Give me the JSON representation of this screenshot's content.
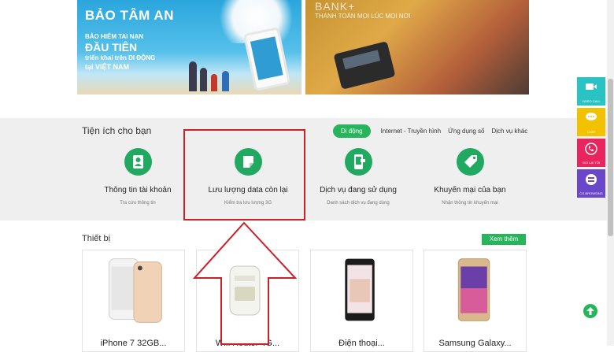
{
  "banner_left": {
    "title": "BẢO TÂM AN",
    "line1": "BẢO HIỂM TAI NẠN",
    "line2": "ĐẦU TIÊN",
    "line3": "triển khai trên DI ĐỘNG",
    "line4": "tại VIỆT NAM"
  },
  "banner_right": {
    "title": "BANK+",
    "subtitle": "THANH TOÁN MỌI LÚC MỌI NƠI"
  },
  "utilities": {
    "title": "Tiện ích cho bạn",
    "tabs": [
      "Di động",
      "Internet - Truyền hình",
      "Ứng dụng số",
      "Dịch vụ khác"
    ],
    "items": [
      {
        "label": "Thông tin tài khoản",
        "desc": "Tra cứu thông tin",
        "icon": "user-icon"
      },
      {
        "label": "Lưu lượng data còn lại",
        "desc": "Kiểm tra lưu lượng 3G",
        "icon": "data-pie-icon"
      },
      {
        "label": "Dịch vụ đang sử dụng",
        "desc": "Danh sách dịch vụ đang dùng",
        "icon": "phone-services-icon"
      },
      {
        "label": "Khuyến mại của bạn",
        "desc": "Nhận thông tin khuyến mại",
        "icon": "tag-icon"
      }
    ]
  },
  "devices": {
    "title": "Thiết bị",
    "view_more": "Xem thêm",
    "items": [
      {
        "name": "iPhone 7 32GB..."
      },
      {
        "name": "Wifi Router 4G..."
      },
      {
        "name": "Điện thoại..."
      },
      {
        "name": "Samsung Galaxy..."
      }
    ]
  },
  "float_bar": {
    "items": [
      {
        "label": "VIDEO CALL",
        "color": "#29c3c3",
        "icon": "video-call-icon"
      },
      {
        "label": "CHAT",
        "color": "#f2c200",
        "icon": "chat-icon"
      },
      {
        "label": "GỌI LẠI TÔI",
        "color": "#e8255e",
        "icon": "callback-icon"
      },
      {
        "label": "CO-BROWSING",
        "color": "#6a46c8",
        "icon": "co-browsing-icon"
      }
    ]
  },
  "colors": {
    "accent_green": "#21a861",
    "highlight_red": "#cc1f26"
  }
}
